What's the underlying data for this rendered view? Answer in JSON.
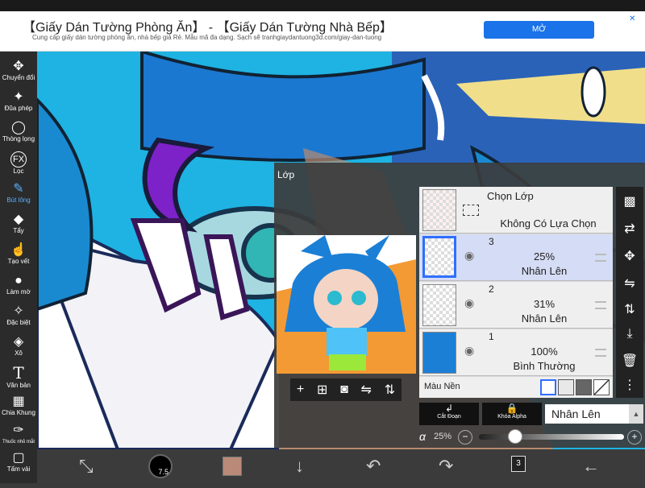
{
  "ad": {
    "title": "【Giấy Dán Tường Phòng Ăn】 - 【Giấy Dán Tường Nhà Bếp】",
    "subtitle": "Cung cấp giấy dán tường phòng ăn, nhà bếp giá Rẻ. Mẫu mã đa dạng. Sạch sẽ tranhgiaydantuong3d.com/giay-dan-tuong",
    "open_button": "MỞ",
    "corner": "✕"
  },
  "toolbar": {
    "tools": [
      {
        "label": "Chuyển đổi",
        "icon": "move-icon",
        "glyph": "✥"
      },
      {
        "label": "Đũa phép",
        "icon": "magic-wand-icon",
        "glyph": "✦"
      },
      {
        "label": "Thòng lọng",
        "icon": "lasso-icon",
        "glyph": "◯"
      },
      {
        "label": "Lọc",
        "icon": "fx-icon",
        "glyph": "FX"
      },
      {
        "label": "Bút lông",
        "icon": "brush-icon",
        "glyph": "✎"
      },
      {
        "label": "Tẩy",
        "icon": "eraser-icon",
        "glyph": "◆"
      },
      {
        "label": "Tạo vết",
        "icon": "smudge-icon",
        "glyph": "☝"
      },
      {
        "label": "Làm mờ",
        "icon": "blur-icon",
        "glyph": "●"
      },
      {
        "label": "Đặc biệt",
        "icon": "special-icon",
        "glyph": "✧"
      },
      {
        "label": "Xô",
        "icon": "bucket-icon",
        "glyph": "◈"
      },
      {
        "label": "Văn bản",
        "icon": "text-icon",
        "glyph": "T"
      },
      {
        "label": "Chia Khung",
        "icon": "frame-divider-icon",
        "glyph": "▦"
      },
      {
        "label": "Thuốc nhỏ mắt",
        "icon": "eyedropper-icon",
        "glyph": "✑"
      },
      {
        "label": "Tấm vải",
        "icon": "canvas-icon",
        "glyph": "▢"
      }
    ],
    "active_label": "Bút lông"
  },
  "bottom": {
    "brush_size": "7.5",
    "color": "#b98a78",
    "layer_count": "3"
  },
  "panel": {
    "title": "Lớp",
    "select_layer_label": "Chọn Lớp",
    "no_selection": "Không Có Lựa Chọn",
    "layers": [
      {
        "num": "3",
        "opacity": "25%",
        "mode": "Nhân Lên",
        "selected": true
      },
      {
        "num": "2",
        "opacity": "31%",
        "mode": "Nhân Lên",
        "selected": false
      },
      {
        "num": "1",
        "opacity": "100%",
        "mode": "Bình Thường",
        "selected": false
      }
    ],
    "background_label": "Màu Nền",
    "clip_label": "Cắt Đoạn",
    "alpha_lock_label": "Khóa Alpha",
    "blend_mode": "Nhân Lên",
    "alpha_symbol": "α",
    "alpha_value": "25%",
    "alpha_fraction": 0.25
  },
  "colors": {
    "accent": "#2f6fff",
    "canvas_blue": "#1fb6e6",
    "ad_button": "#1a73e8"
  }
}
